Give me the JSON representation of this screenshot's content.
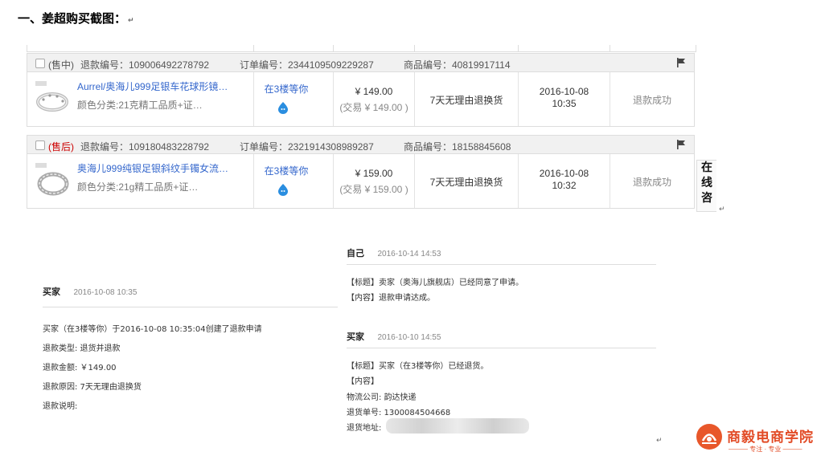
{
  "heading": "一、姜超购买截图：",
  "return_mark": "↵",
  "orders": [
    {
      "status": "(售中)",
      "refund_no": "退款编号：109006492278792",
      "order_no": "订单编号：2344109509229287",
      "product_no": "商品编号：40819917114",
      "title": "Aurrel/奥海儿999足银车花球形镜…",
      "sku": "颜色分类:21克精工品质+证…",
      "seller": "在3楼等你",
      "price": "¥ 149.00",
      "trade_price": "(交易 ¥ 149.00 )",
      "service": "7天无理由退换货",
      "date": "2016-10-08",
      "time": "10:35",
      "refund_status": "退款成功"
    },
    {
      "status": "(售后)",
      "refund_no": "退款编号：109180483228792",
      "order_no": "订单编号：2321914308989287",
      "product_no": "商品编号：18158845608",
      "title": "奥海儿999纯银足银斜纹手镯女流…",
      "sku": "颜色分类:21g精工品质+证…",
      "seller": "在3楼等你",
      "price": "¥ 159.00",
      "trade_price": "(交易 ¥ 159.00 )",
      "service": "7天无理由退换货",
      "date": "2016-10-08",
      "time": "10:32",
      "refund_status": "退款成功"
    }
  ],
  "chat_tab": "在线咨",
  "left_message": {
    "name": "买家",
    "time": "2016-10-08 10:35",
    "lines": [
      "买家（在3楼等你）于2016-10-08 10:35:04创建了退款申请",
      "退款类型: 退货并退款",
      "退款金额: ￥149.00",
      "退款原因: 7天无理由退换货",
      "退款说明:"
    ]
  },
  "right_messages": [
    {
      "name": "自己",
      "time": "2016-10-14 14:53",
      "lines": [
        "【标题】卖家（奥海儿旗舰店）已经同意了申请。",
        "【内容】退款申请达成。"
      ]
    },
    {
      "name": "买家",
      "time": "2016-10-10 14:55",
      "lines": [
        "【标题】买家（在3楼等你）已经退货。",
        "【内容】",
        "物流公司: 韵达快递",
        "退货单号: 1300084504668",
        "退货地址:"
      ]
    }
  ],
  "logo": {
    "name": "商毅电商学院",
    "slogan": "——— 专注 · 专业 ———"
  },
  "colors": {
    "link": "#3366cc",
    "status_red": "#cc0000",
    "logo_red": "#e24b26"
  }
}
